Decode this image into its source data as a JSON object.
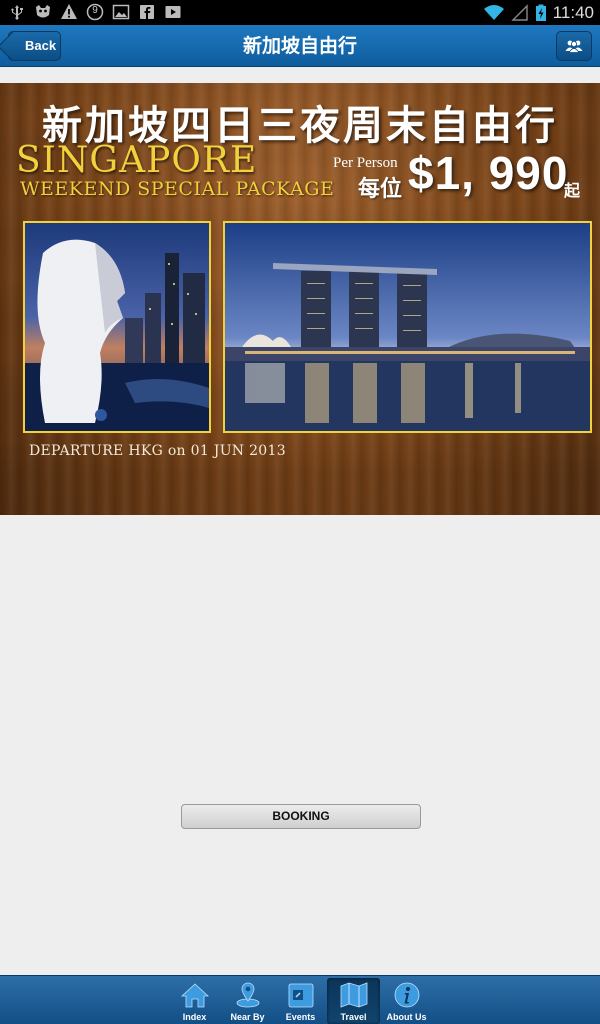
{
  "status_bar": {
    "time": "11:40",
    "notification_count": "9",
    "icons_left": [
      "usb-icon",
      "android-debug-icon",
      "warning-icon",
      "notification-count-icon",
      "image-icon",
      "facebook-icon",
      "play-icon"
    ],
    "icons_right": [
      "wifi-icon",
      "signal-icon",
      "battery-icon"
    ]
  },
  "header": {
    "back_label": "Back",
    "title": "新加坡自由行",
    "right_icon": "people-icon"
  },
  "banner": {
    "title_zh": "新加坡四日三夜周末自由行",
    "title_en": "SINGAPORE",
    "subtitle_en": "WEEKEND SPECIAL PACKAGE",
    "per_person": "Per Person",
    "each_zh": "每位",
    "price": "$1, 990",
    "from_zh": "起",
    "departure": "DEPARTURE HKG on 01 JUN 2013"
  },
  "booking": {
    "label": "BOOKING"
  },
  "tabbar": {
    "active": "Travel",
    "tabs": [
      {
        "label": "Index",
        "icon": "home-icon"
      },
      {
        "label": "Near By",
        "icon": "location-icon"
      },
      {
        "label": "Events",
        "icon": "calendar-icon"
      },
      {
        "label": "Travel",
        "icon": "map-icon"
      },
      {
        "label": "About Us",
        "icon": "info-icon"
      }
    ]
  },
  "colors": {
    "header_blue": "#1f78bf",
    "tabbar_blue": "#124f86",
    "banner_gold": "#f2d23c",
    "wood_brown": "#7a4418",
    "page_bg": "#eeeeee"
  }
}
